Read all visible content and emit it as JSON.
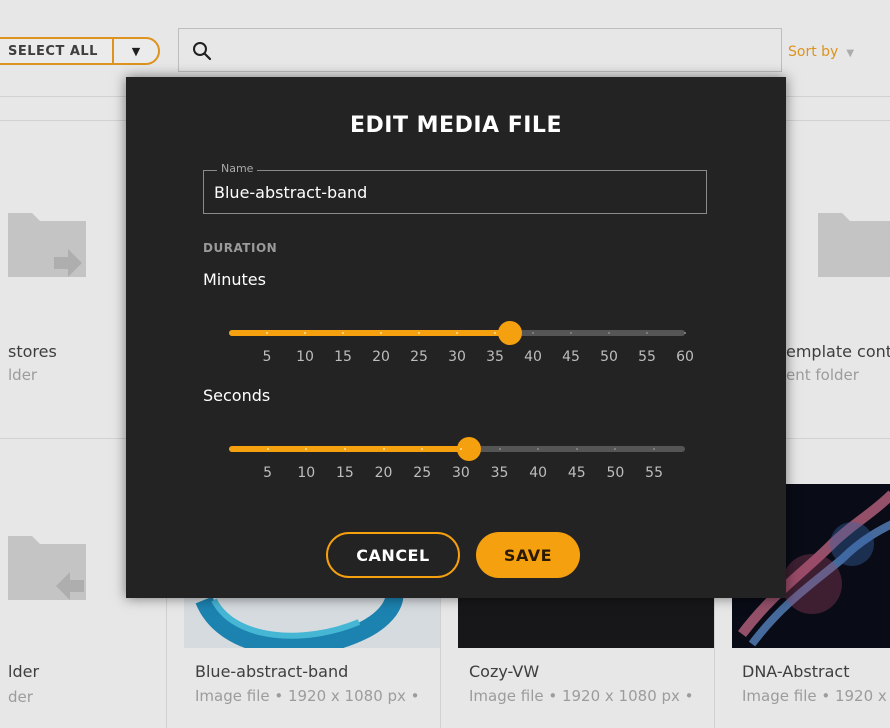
{
  "toolbar": {
    "select_all_label": "SELECT ALL",
    "search_placeholder": "",
    "sort_label": "Sort by"
  },
  "background_cards": [
    {
      "title": "stores",
      "subtitle": "lder"
    },
    {
      "title": "emplate cont",
      "subtitle": "ent folder"
    },
    {
      "title": "lder",
      "subtitle": "der"
    },
    {
      "title": "Blue-abstract-band",
      "subtitle": "Image file • 1920 x 1080 px •"
    },
    {
      "title": "Cozy-VW",
      "subtitle": "Image file • 1920 x 1080 px •"
    },
    {
      "title": "DNA-Abstract",
      "subtitle": "Image file • 1920 x"
    }
  ],
  "modal": {
    "title": "EDIT MEDIA FILE",
    "name_label": "Name",
    "name_value": "Blue-abstract-band",
    "duration_label": "DURATION",
    "minutes": {
      "label": "Minutes",
      "min": 0,
      "max": 60,
      "value": 37,
      "ticks": [
        "5",
        "10",
        "15",
        "20",
        "25",
        "30",
        "35",
        "40",
        "45",
        "50",
        "55",
        "60"
      ]
    },
    "seconds": {
      "label": "Seconds",
      "min": 0,
      "max": 59,
      "value": 31,
      "ticks": [
        "5",
        "10",
        "15",
        "20",
        "25",
        "30",
        "35",
        "40",
        "45",
        "50",
        "55"
      ]
    },
    "cancel_label": "CANCEL",
    "save_label": "SAVE"
  },
  "colors": {
    "accent": "#f5a00e",
    "modal_bg": "#232323"
  }
}
